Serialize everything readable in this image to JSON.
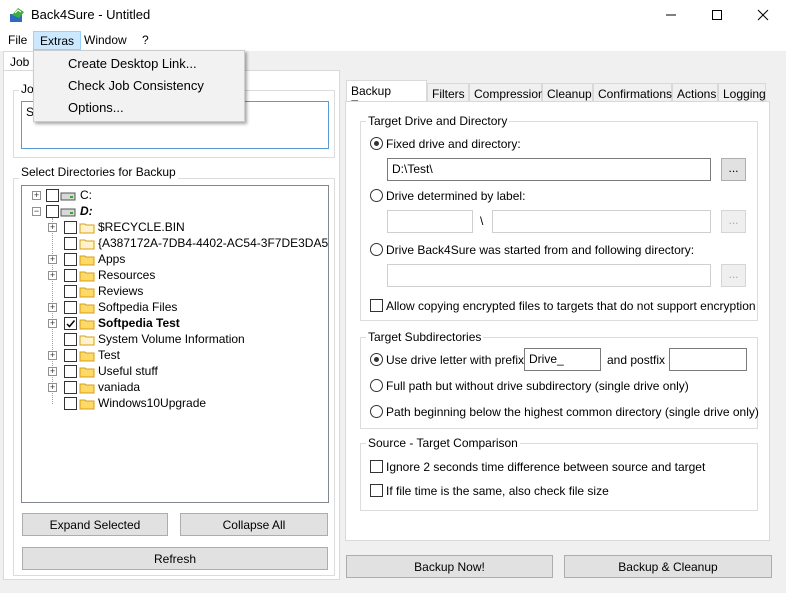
{
  "window": {
    "title": "Back4Sure - Untitled"
  },
  "menubar": {
    "items": [
      "File",
      "Extras",
      "Window",
      "?"
    ]
  },
  "extras_menu": {
    "items": [
      "Create Desktop Link...",
      "Check Job Consistency",
      "Options..."
    ]
  },
  "job_tab": {
    "label": "Job S"
  },
  "job_group": {
    "legend": "Jo",
    "value": "S"
  },
  "directories": {
    "legend": "Select Directories for Backup",
    "drives": [
      "C:",
      "D:"
    ],
    "folders": [
      "$RECYCLE.BIN",
      "{A387172A-7DB4-4402-AC54-3F7DE3DA5055}",
      "Apps",
      "Resources",
      "Reviews",
      "Softpedia Files",
      "Softpedia Test",
      "System Volume Information",
      "Test",
      "Useful stuff",
      "vaniada",
      "Windows10Upgrade"
    ]
  },
  "left_buttons": {
    "expand": "Expand Selected",
    "collapse": "Collapse All",
    "refresh": "Refresh"
  },
  "tabs": [
    "Backup Target",
    "Filters",
    "Compression",
    "Cleanup",
    "Confirmations",
    "Actions",
    "Logging"
  ],
  "target": {
    "legend": "Target Drive and Directory",
    "fixed_label": "Fixed drive and directory:",
    "fixed_value": "D:\\Test\\",
    "browse": "...",
    "label_option": "Drive determined by label:",
    "separator": "\\",
    "started_option": "Drive Back4Sure was started from and following directory:",
    "allow_encrypted": "Allow copying encrypted files to targets that do not support encryption"
  },
  "subdirs": {
    "legend": "Target Subdirectories",
    "opt1": "Use drive letter with prefix",
    "prefix_value": "Drive_",
    "and_postfix": "and postfix",
    "opt2": "Full path but without drive subdirectory (single drive only)",
    "opt3": "Path beginning below the highest common directory (single drive only)"
  },
  "compare": {
    "legend": "Source - Target Comparison",
    "opt1": "Ignore 2 seconds time difference between source and target",
    "opt2": "If file time is the same, also check file size"
  },
  "bottom_buttons": {
    "backup_now": "Backup Now!",
    "backup_cleanup": "Backup & Cleanup"
  }
}
